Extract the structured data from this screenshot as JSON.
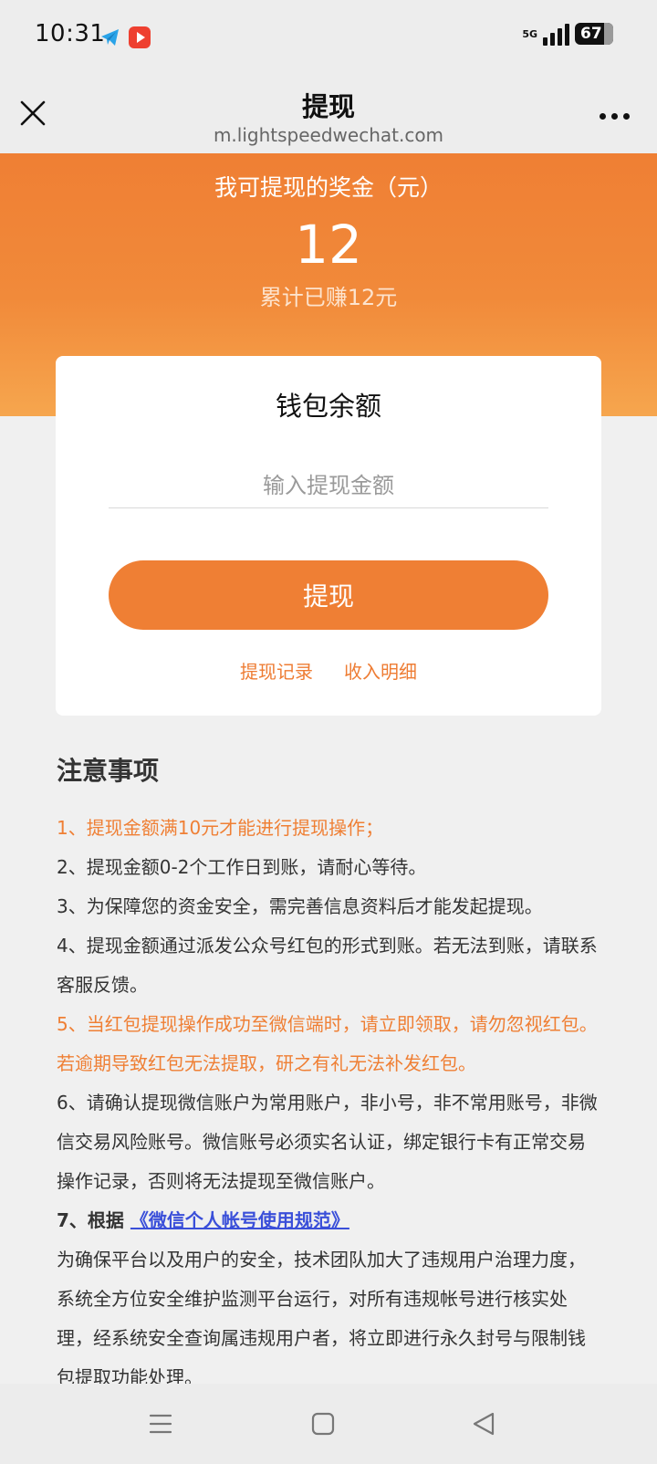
{
  "status_bar": {
    "time": "10:31",
    "app_icons": [
      "telegram-icon",
      "video-player-icon"
    ],
    "network": "5G",
    "battery": "67"
  },
  "nav": {
    "title": "提现",
    "url": "m.lightspeedwechat.com",
    "close_icon": "close-icon",
    "more_icon": "more-icon"
  },
  "hero": {
    "label": "我可提现的奖金（元）",
    "amount": "12",
    "total_earned": "累计已赚12元"
  },
  "card": {
    "title": "钱包余额",
    "input_placeholder": "输入提现金额",
    "button_label": "提现",
    "links": [
      "提现记录",
      "收入明细"
    ]
  },
  "notes": {
    "title": "注意事项",
    "items": [
      "1、提现金额满10元才能进行提现操作；",
      "2、提现金额0-2个工作日到账，请耐心等待。",
      "3、为保障您的资金安全，需完善信息资料后才能发起提现。",
      "4、提现金额通过派发公众号红包的形式到账。若无法到账，请联系客服反馈。",
      "5、当红包提现操作成功至微信端时，请立即领取，请勿忽视红包。若逾期导致红包无法提取，研之有礼无法补发红包。",
      "6、请确认提现微信账户为常用账户，非小号，非不常用账号，非微信交易风险账号。微信账号必须实名认证，绑定银行卡有正常交易操作记录，否则将无法提现至微信账户。"
    ],
    "item7_prefix": "7、根据",
    "item7_link": "《微信个人帐号使用规范》",
    "item7_body": "为确保平台以及用户的安全，技术团队加大了违规用户治理力度，系统全方位安全维护监测平台运行，对所有违规帐号进行核实处理，经系统安全查询属违规用户者，将立即进行永久封号与限制钱包提取功能处理。"
  },
  "colors": {
    "accent": "#ef7f34",
    "link": "#3a4fd9",
    "background": "#f0f0f0"
  },
  "system_nav": [
    "menu-icon",
    "home-icon",
    "back-icon"
  ]
}
